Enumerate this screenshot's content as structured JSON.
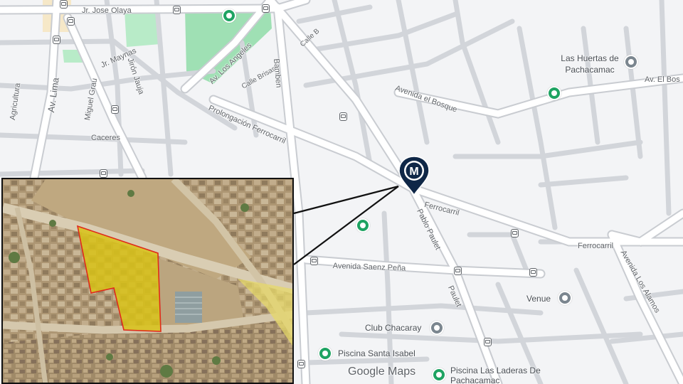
{
  "map": {
    "colors": {
      "background": "#f3f4f6",
      "road": "#ffffff",
      "road_edge": "#c9ccd1",
      "park": "#9fe0b4",
      "poi_green": "#1ea362",
      "poi_gray": "#7b868f",
      "marker": "#0f2747",
      "parcel": "#d8c216"
    },
    "marker": {
      "letter": "M",
      "icon": "map-marker-m-icon"
    },
    "streets": [
      "Jr. Jose Olaya",
      "Jr. Maynas",
      "Jirón Jauja",
      "Av. Los Angeles",
      "Calle Brisas",
      "Calle B",
      "Bamben",
      "Agricultura",
      "Av. Lima",
      "Miguel Grau",
      "Caceres",
      "Prolongación Ferrocarril",
      "Avenida el Bosque",
      "Av. El Bos",
      "Ferrocarril",
      "Pablo Paulet",
      "Avenida Saenz Peña",
      "Paulet",
      "Ferrocarril",
      "Avenida Los Alamos"
    ],
    "places": [
      {
        "name": "Las Huertas de Pachacamac",
        "icon": "gray-poi-icon"
      },
      {
        "name": "Venue",
        "icon": "gray-poi-icon"
      },
      {
        "name": "Club Chacaray",
        "icon": "gray-poi-icon"
      },
      {
        "name": "Piscina Santa Isabel",
        "icon": "green-poi-icon"
      },
      {
        "name": "Piscina Las Laderas De Pachacamac",
        "icon": "green-poi-icon"
      }
    ],
    "attribution": "Google Maps",
    "inset": {
      "kind": "satellite-view",
      "highlight_color": "#d8c216",
      "boundary_color": "#e02a1a"
    }
  }
}
